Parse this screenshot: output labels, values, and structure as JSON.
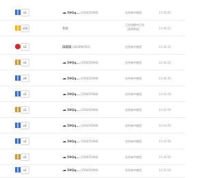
{
  "rows": [
    {
      "gift_icon": "gift-box-icon",
      "gift_color": "#3a6fc7",
      "qty": "x1",
      "sender": "59Qq...",
      "sender_id": "(256455966)",
      "status": "在所有中使用",
      "time": "23:56:05"
    },
    {
      "gift_icon": "gift-box-icon",
      "gift_color": "#f2b51d",
      "qty": "x10",
      "sender": "系统",
      "sender_id": "",
      "status": "已拉包换中卫兑（获得率低）",
      "time": "23:49:55"
    },
    {
      "gift_icon": "heart-icon",
      "gift_color": "#d22b2b",
      "qty": "x1",
      "sender": "白玩玩",
      "sender_id": "(262898782)",
      "status": "在所有中使用",
      "time": "23:44:21"
    },
    {
      "gift_icon": "gift-box-icon",
      "gift_color": "#c99a3a",
      "qty": "x1",
      "sender": "59Qq...",
      "sender_id": "(256455966)",
      "status": "在所有中使用",
      "time": "23:44:20"
    },
    {
      "gift_icon": "gift-box-icon",
      "gift_color": "#3a6fc7",
      "qty": "x6",
      "sender": "59Qq...",
      "sender_id": "(256455966)",
      "status": "在所有中使用",
      "time": "23:44:20"
    },
    {
      "gift_icon": "gift-box-icon",
      "gift_color": "#3a6fc7",
      "qty": "x1",
      "sender": "59Qq...",
      "sender_id": "(256455966)",
      "status": "在所有中使用",
      "time": "23:43:59"
    },
    {
      "gift_icon": "gift-box-icon",
      "gift_color": "#c99a3a",
      "qty": "x1",
      "sender": "59Qq...",
      "sender_id": "(256455966)",
      "status": "在所有中使用",
      "time": "23:43:59"
    },
    {
      "gift_icon": "gift-box-icon",
      "gift_color": "#3a6fc7",
      "qty": "x2",
      "sender": "59Qq...",
      "sender_id": "(256455966)",
      "status": "在所有中使用",
      "time": "23:43:59"
    },
    {
      "gift_icon": "gift-box-icon",
      "gift_color": "#3a6fc7",
      "qty": "x1",
      "sender": "59Qq...",
      "sender_id": "(256455966)",
      "status": "在所有中使用",
      "time": "23:43:59"
    },
    {
      "gift_icon": "gift-box-icon",
      "gift_color": "#c99a3a",
      "qty": "x1",
      "sender": "59Qq...",
      "sender_id": "(256455966)",
      "status": "在所有中使用",
      "time": "23:43:59"
    },
    {
      "gift_icon": "gift-box-icon",
      "gift_color": "#3a6fc7",
      "qty": "x1",
      "sender": "59Qq...",
      "sender_id": "(256455966)",
      "status": "在所有中使用",
      "time": "23:43:59"
    }
  ]
}
